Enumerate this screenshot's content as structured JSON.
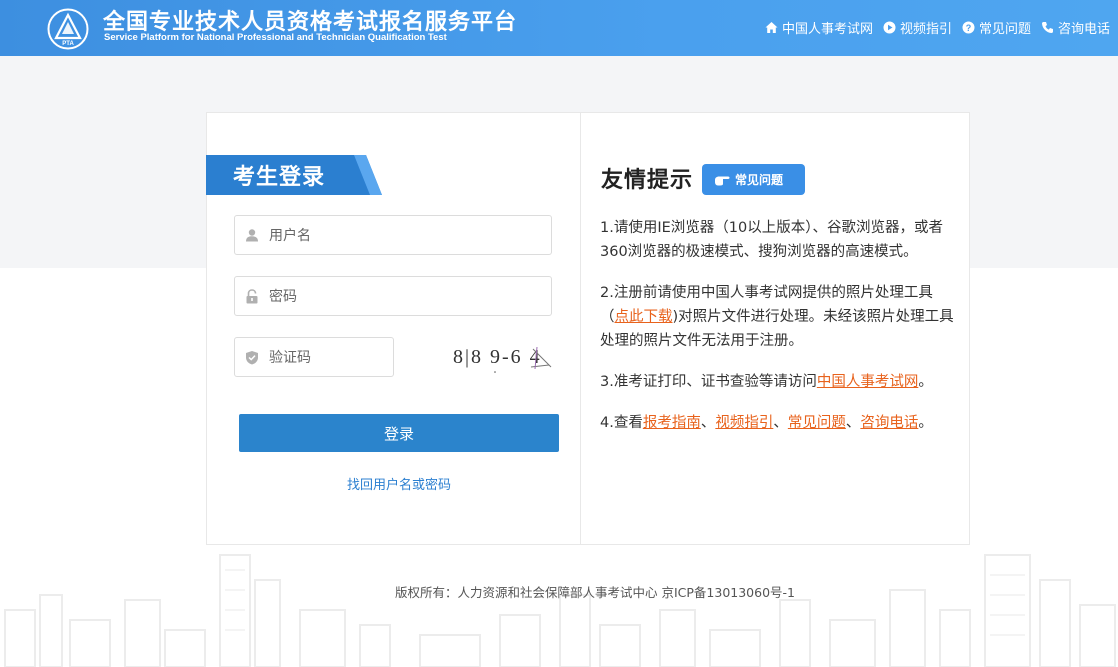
{
  "header": {
    "title_cn": "全国专业技术人员资格考试报名服务平台",
    "title_en": "Service Platform for National Professional and Technician Qualification Test",
    "logo_text": "PTA",
    "nav": [
      {
        "label": "中国人事考试网",
        "icon": "home-icon"
      },
      {
        "label": "视频指引",
        "icon": "play-icon"
      },
      {
        "label": "常见问题",
        "icon": "question-icon"
      },
      {
        "label": "咨询电话",
        "icon": "phone-icon"
      }
    ]
  },
  "login": {
    "title": "考生登录",
    "username_placeholder": "用户名",
    "password_placeholder": "密码",
    "captcha_placeholder": "验证码",
    "captcha_text": "8|8 9-6 4",
    "submit_label": "登录",
    "forgot_label": "找回用户名或密码"
  },
  "tips": {
    "title": "友情提示",
    "faq_badge": "常见问题",
    "item1": "1.请使用IE浏览器（10以上版本）、谷歌浏览器，或者360浏览器的极速模式、搜狗浏览器的高速模式。",
    "item2_pre": "2.注册前请使用中国人事考试网提供的照片处理工具（",
    "item2_link": "点此下载",
    "item2_post": ")对照片文件进行处理。未经该照片处理工具处理的照片文件无法用于注册。",
    "item3_pre": "3.准考证打印、证书查验等请访问",
    "item3_link": "中国人事考试网",
    "item3_post": "。",
    "item4_pre": "4.查看",
    "item4_links": [
      "报考指南",
      "视频指引",
      "常见问题",
      "咨询电话"
    ],
    "item4_sep": "、",
    "item4_post": "。"
  },
  "footer": {
    "text": "版权所有：人力资源和社会保障部人事考试中心 京ICP备13013060号-1"
  },
  "colors": {
    "header_blue": "#4a9ded",
    "button_blue": "#2b84cc",
    "ribbon_blue": "#2b7fd0",
    "link_orange": "#e8621c",
    "band_grey": "#f4f5f7"
  }
}
